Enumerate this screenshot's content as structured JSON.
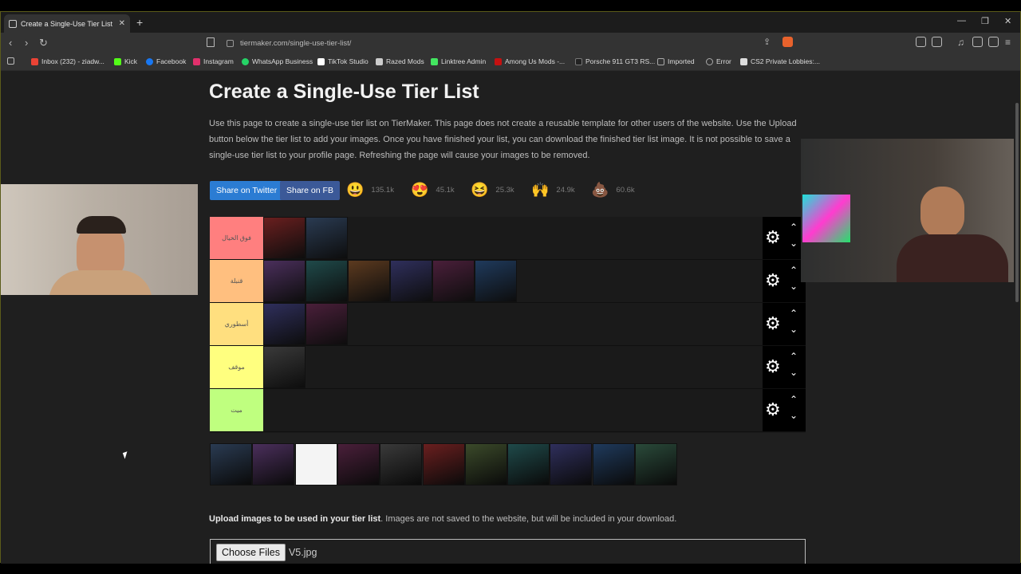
{
  "browser": {
    "tab_title": "Create a Single-Use Tier List (Pr...",
    "url": "tiermaker.com/single-use-tier-list/",
    "bookmarks": [
      {
        "label": "Inbox (232) - ziadw...",
        "color": "#ea4335"
      },
      {
        "label": "Kick",
        "color": "#53fc18"
      },
      {
        "label": "Facebook",
        "color": "#1877f2"
      },
      {
        "label": "Instagram",
        "color": "#e1306c"
      },
      {
        "label": "WhatsApp Business",
        "color": "#25d366"
      },
      {
        "label": "TikTok Studio",
        "color": "#ffffff"
      },
      {
        "label": "Razed Mods",
        "color": "#cccccc"
      },
      {
        "label": "Linktree Admin",
        "color": "#43e660"
      },
      {
        "label": "Among Us Mods -...",
        "color": "#c51111"
      },
      {
        "label": "Porsche 911 GT3 RS...",
        "color": "#222222"
      },
      {
        "label": "Imported",
        "color": "#aaaaaa"
      },
      {
        "label": "Error",
        "color": "#aaaaaa"
      },
      {
        "label": "CS2 Private Lobbies:...",
        "color": "#dddddd"
      }
    ]
  },
  "page": {
    "title": "Create a Single-Use Tier List",
    "description": "Use this page to create a single-use tier list on TierMaker. This page does not create a reusable template for other users of the website. Use the Upload button below the tier list to add your images. Once you have finished your list, you can download the finished tier list image. It is not possible to save a single-use tier list to your profile page. Refreshing the page will cause your images to be removed.",
    "share_twitter": "Share on Twitter",
    "share_fb": "Share on FB",
    "reactions": [
      {
        "emoji": "😃",
        "count": "135.1k"
      },
      {
        "emoji": "😍",
        "count": "45.1k"
      },
      {
        "emoji": "😆",
        "count": "25.3k"
      },
      {
        "emoji": "🙌",
        "count": "24.9k"
      },
      {
        "emoji": "💩",
        "count": "60.6k"
      }
    ],
    "tiers": [
      {
        "label": "فوق الخيال",
        "color": "#ff7f7f",
        "tiles": 2
      },
      {
        "label": "قنبلة",
        "color": "#ffbf7f",
        "tiles": 6
      },
      {
        "label": "أسطوري",
        "color": "#ffdf7f",
        "tiles": 2
      },
      {
        "label": "موقف",
        "color": "#ffff7f",
        "tiles": 1
      },
      {
        "label": "ميت",
        "color": "#bfff7f",
        "tiles": 0
      }
    ],
    "pool_count": 11,
    "upload_bold": "Upload images to be used in your tier list",
    "upload_rest": ". Images are not saved to the website, but will be included in your download.",
    "choose_files": "Choose Files",
    "file_name": "V5.jpg"
  }
}
